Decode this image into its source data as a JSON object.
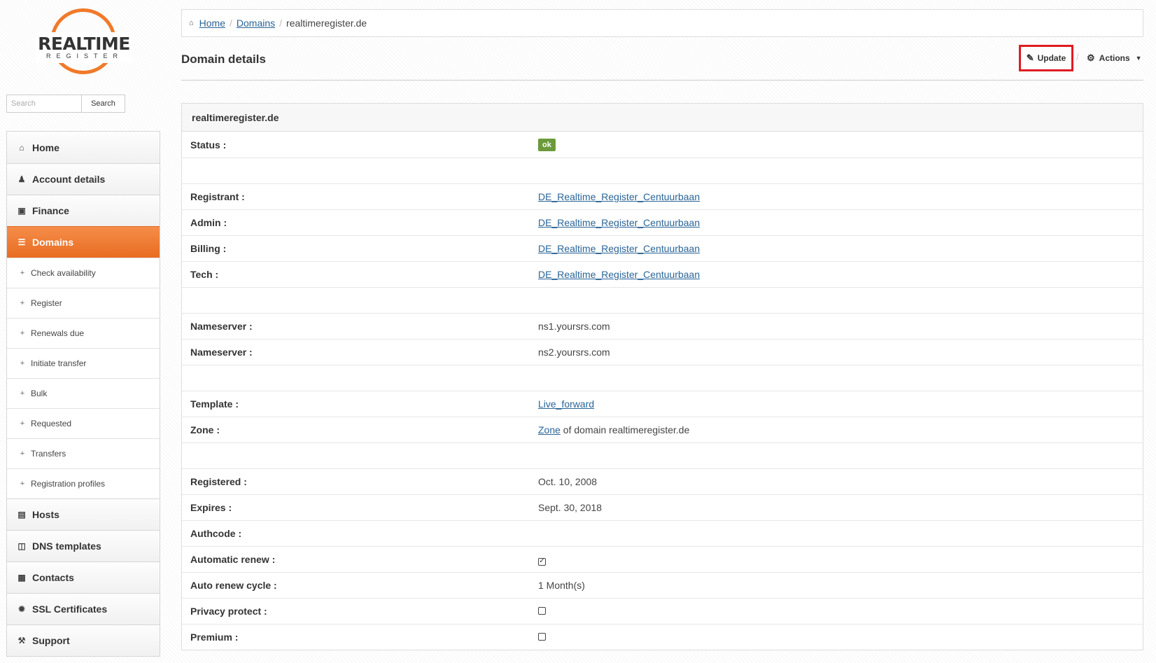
{
  "logo": {
    "brand": "REALTIME",
    "sub": "REGISTER"
  },
  "search": {
    "placeholder": "Search",
    "button_label": "Search"
  },
  "nav": {
    "items": [
      {
        "label": "Home",
        "icon": "home-icon"
      },
      {
        "label": "Account details",
        "icon": "user-icon"
      },
      {
        "label": "Finance",
        "icon": "money-icon"
      },
      {
        "label": "Domains",
        "icon": "list-icon",
        "active": true
      },
      {
        "label": "Hosts",
        "icon": "hdd-icon"
      },
      {
        "label": "DNS templates",
        "icon": "columns-icon"
      },
      {
        "label": "Contacts",
        "icon": "book-icon"
      },
      {
        "label": "SSL Certificates",
        "icon": "certificate-icon"
      },
      {
        "label": "Support",
        "icon": "wrench-icon"
      }
    ],
    "domains_sub": [
      "Check availability",
      "Register",
      "Renewals due",
      "Initiate transfer",
      "Bulk",
      "Requested",
      "Transfers",
      "Registration profiles"
    ]
  },
  "breadcrumb": {
    "home": "Home",
    "domains": "Domains",
    "current": "realtimeregister.de"
  },
  "page": {
    "title": "Domain details",
    "update_label": "Update",
    "actions_label": "Actions"
  },
  "panel": {
    "header": "realtimeregister.de",
    "status_label": "Status :",
    "status_value": "ok",
    "registrant_label": "Registrant :",
    "registrant_value": "DE_Realtime_Register_Centuurbaan",
    "admin_label": "Admin :",
    "admin_value": "DE_Realtime_Register_Centuurbaan",
    "billing_label": "Billing :",
    "billing_value": "DE_Realtime_Register_Centuurbaan",
    "tech_label": "Tech :",
    "tech_value": "DE_Realtime_Register_Centuurbaan",
    "ns1_label": "Nameserver :",
    "ns1_value": "ns1.yoursrs.com",
    "ns2_label": "Nameserver :",
    "ns2_value": "ns2.yoursrs.com",
    "template_label": "Template :",
    "template_value": "Live_forward",
    "zone_label": "Zone :",
    "zone_link": "Zone",
    "zone_text": " of domain realtimeregister.de",
    "registered_label": "Registered :",
    "registered_value": "Oct. 10, 2008",
    "expires_label": "Expires :",
    "expires_value": "Sept. 30, 2018",
    "authcode_label": "Authcode :",
    "autorenew_label": "Automatic renew :",
    "autorenew_checked": true,
    "cycle_label": "Auto renew cycle :",
    "cycle_value": "1 Month(s)",
    "privacy_label": "Privacy protect :",
    "privacy_checked": false,
    "premium_label": "Premium :",
    "premium_checked": false
  },
  "colors": {
    "accent": "#f07a2a",
    "status_ok": "#6b9a3c",
    "highlight": "#e01b22",
    "link": "#2a6496"
  }
}
